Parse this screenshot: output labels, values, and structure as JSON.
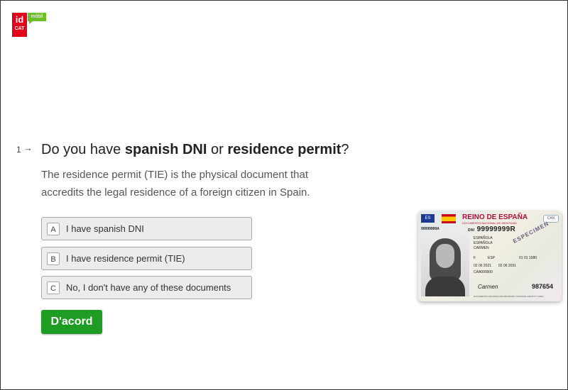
{
  "logo": {
    "line1": "id",
    "line2": "CAT",
    "badge": "mòbil",
    "colors": {
      "red": "#e2001a",
      "green": "#6dbf2a"
    }
  },
  "question": {
    "number": "1",
    "arrow": "→",
    "title_parts": [
      "Do you have ",
      "spanish DNI",
      " or ",
      "residence permit",
      "?"
    ],
    "description": "The residence permit (TIE) is the physical document that accredits the legal residence of a foreign citizen in Spain."
  },
  "options": [
    {
      "key": "A",
      "label": "I have spanish DNI"
    },
    {
      "key": "B",
      "label": "I have residence permit (TIE)"
    },
    {
      "key": "C",
      "label": "No, I don't have any of these documents"
    }
  ],
  "ok_button": {
    "label": "D'acord",
    "color": "#1f9c23"
  },
  "id_card": {
    "eu_code": "ES",
    "title": "REINO DE ESPAÑA",
    "subtitle": "DOCUMENTO NACIONAL DE IDENTIDAD",
    "chip": "CAN",
    "small_number": "99999999A",
    "dni_prefix": "DNI",
    "dni_number": "99999999R",
    "surname1": "ESPAÑOLA",
    "surname2": "ESPAÑOLA",
    "name": "CARMEN",
    "sex": "F",
    "nationality": "ESP",
    "birth_date": "01 01 1980",
    "issue_date": "02 06 2021",
    "expiry_date": "02 06 2031",
    "support_number": "CAA000000",
    "specimen": "ESPECIMEN",
    "card_number": "987654",
    "footer": "DOCUMENTO NACIONAL DE IDENTIDAD / NATIONAL IDENTITY CARD",
    "signature": "Carmen"
  }
}
